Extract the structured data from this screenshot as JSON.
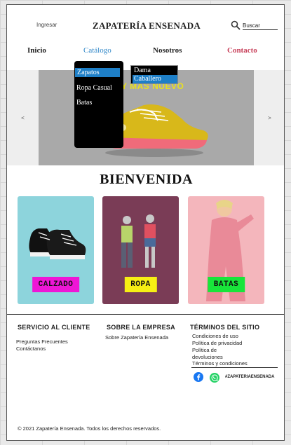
{
  "header": {
    "login_label": "Ingresar",
    "brand": "ZAPATERÍA ENSENADA",
    "search_placeholder": "Buscar"
  },
  "nav": {
    "inicio": "Inicio",
    "catalogo": "Catálogo",
    "nosotros": "Nosotros",
    "contacto": "Contacto"
  },
  "dropdown": {
    "items": [
      "Zapatos",
      "Ropa Casual",
      "Batas"
    ],
    "submenu": [
      "Dama",
      "Caballero"
    ]
  },
  "carousel": {
    "prev": "<",
    "next": ">",
    "caption": "Y MÁS NUEVO"
  },
  "welcome": "BIENVENIDA",
  "categories": [
    {
      "label": "CALZADO",
      "color": "#ee16d6"
    },
    {
      "label": "ROPA",
      "color": "#f6ef14"
    },
    {
      "label": "BATAS",
      "color": "#18e53a"
    }
  ],
  "footer": {
    "servicio": {
      "heading": "SERVICIO AL CLIENTE",
      "links": [
        "Preguntas Frecuentes",
        "Contáctanos"
      ]
    },
    "empresa": {
      "heading": "SOBRE LA EMPRESA",
      "links": [
        "Sobre Zapatería Ensenada"
      ]
    },
    "terminos": {
      "heading": "TÉRMINOS DEL SITIO",
      "links": [
        "Condiciones de uso",
        "Política de privacidad",
        "Política de devoluciones",
        "Términos y condiciones"
      ]
    },
    "hashtag": "#ZAPATERIAENSENADA",
    "copyright": "© 2021 Zapatería Ensenada. Todos los derechos reservados."
  },
  "colors": {
    "accent_blue": "#2e86c8",
    "contact_red": "#c8405a",
    "highlight_blue": "#1e7fc7"
  }
}
